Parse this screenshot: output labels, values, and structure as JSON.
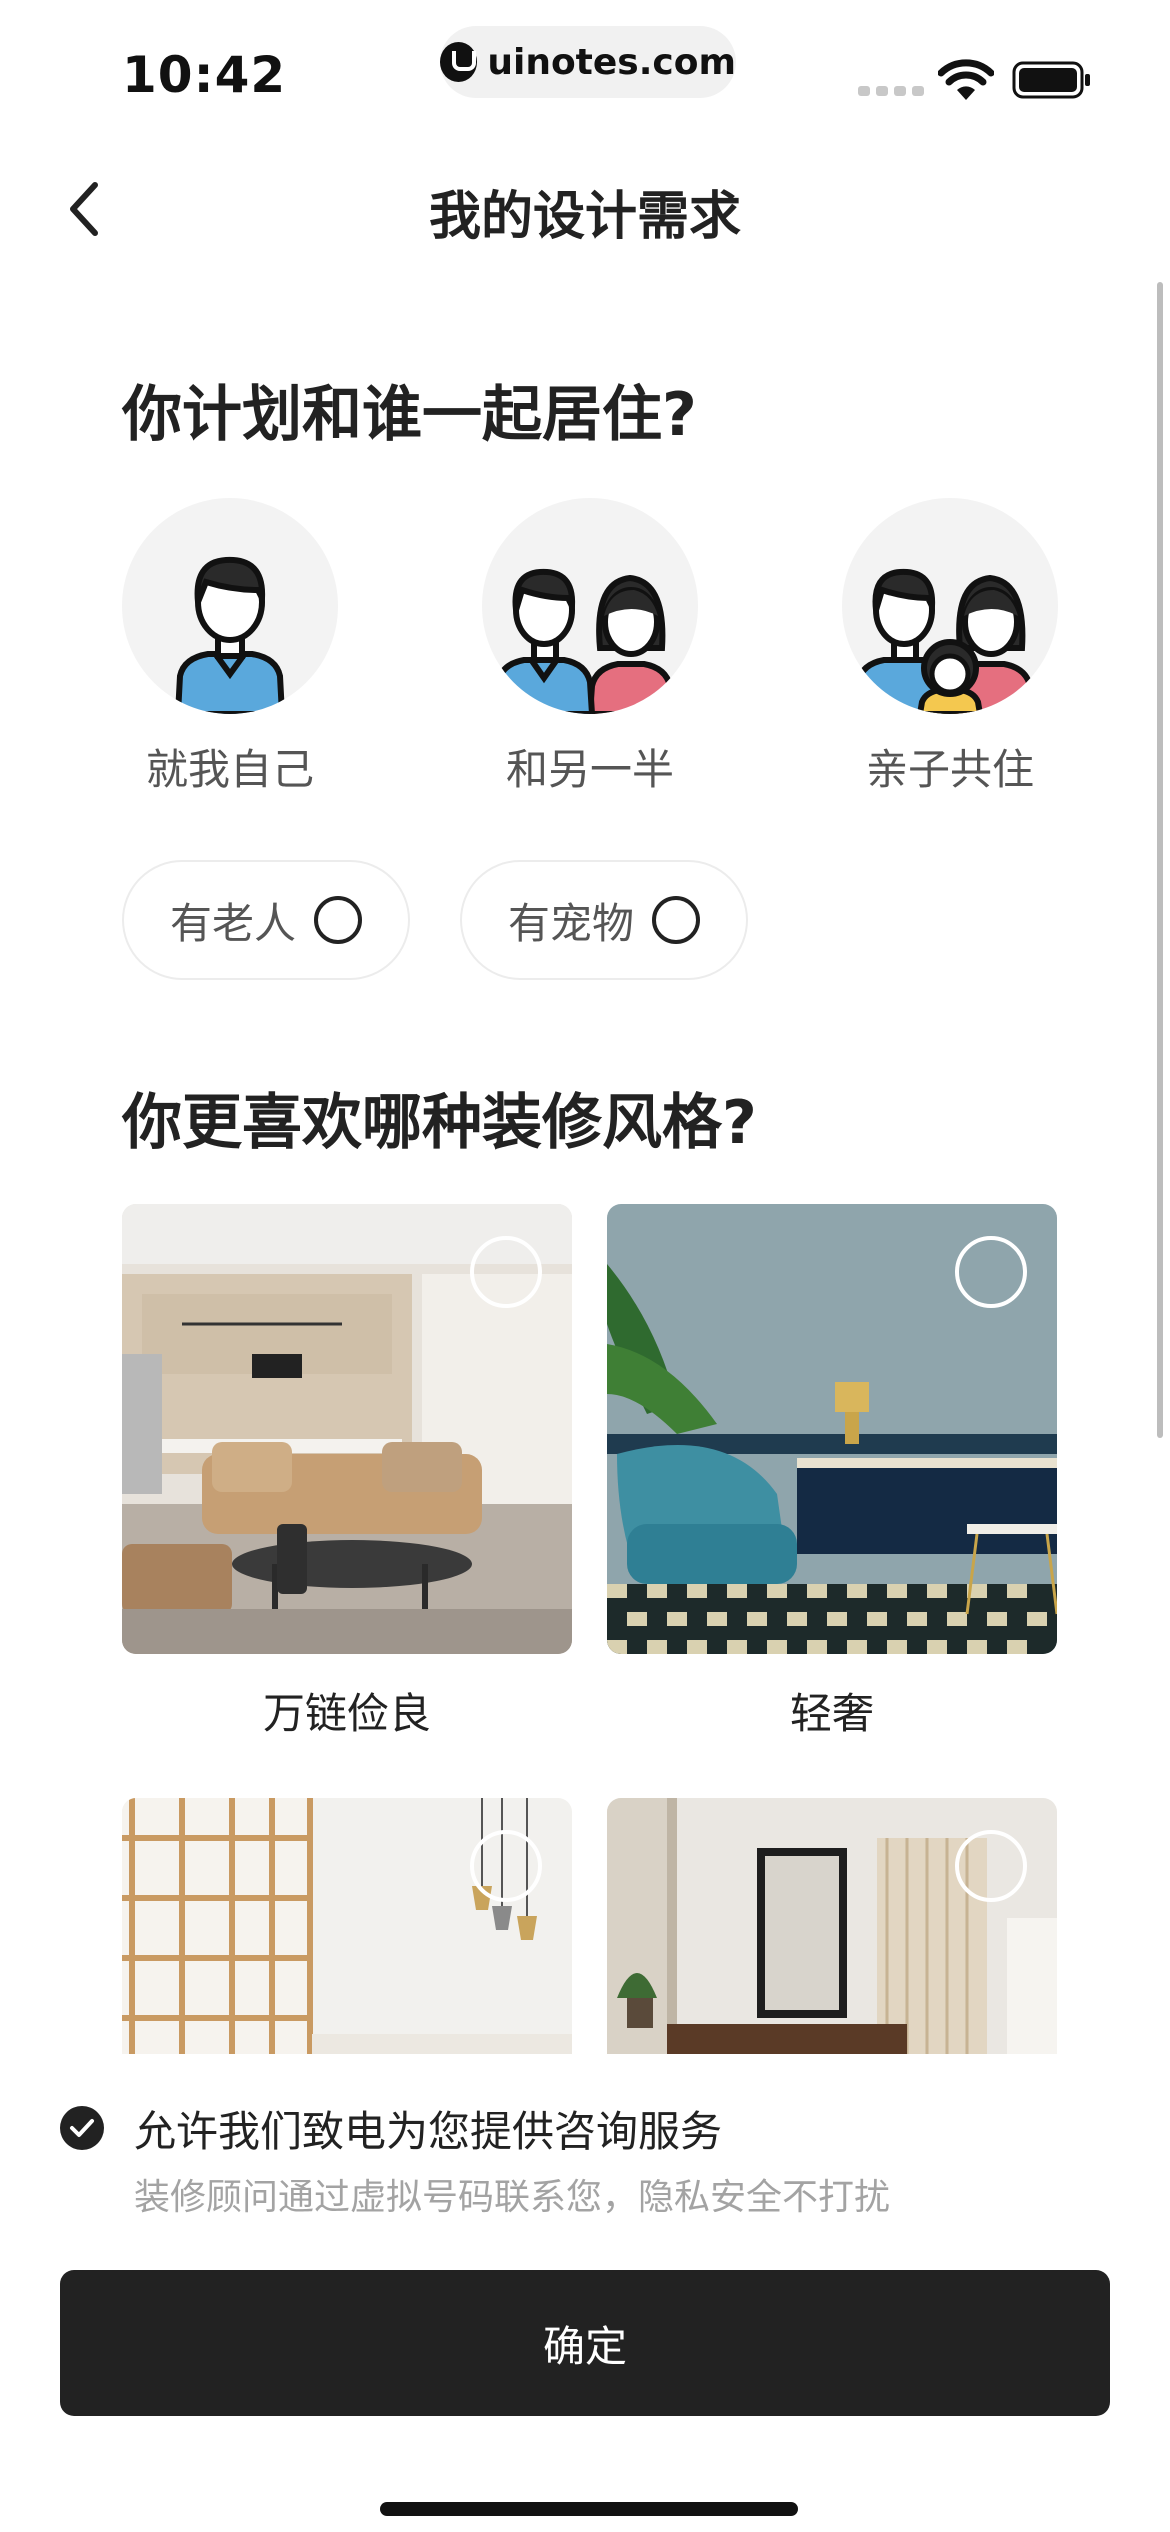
{
  "status_bar": {
    "time": "10:42",
    "url": "uinotes.com"
  },
  "nav": {
    "back_icon": "chevron-left-icon",
    "title": "我的设计需求"
  },
  "residents_section": {
    "title": "你计划和谁一起居住?",
    "options": [
      {
        "label": "就我自己",
        "icon": "single-person-icon"
      },
      {
        "label": "和另一半",
        "icon": "couple-icon"
      },
      {
        "label": "亲子共住",
        "icon": "family-icon"
      }
    ],
    "extras": [
      {
        "label": "有老人"
      },
      {
        "label": "有宠物"
      }
    ]
  },
  "style_section": {
    "title": "你更喜欢哪种装修风格?",
    "styles": [
      {
        "label": "万链俭良"
      },
      {
        "label": "轻奢"
      },
      {
        "label": ""
      },
      {
        "label": ""
      }
    ]
  },
  "consent": {
    "text": "允许我们致电为您提供咨询服务",
    "subtext": "装修顾问通过虚拟号码联系您，隐私安全不打扰"
  },
  "confirm_button": "确定",
  "colors": {
    "primary": "#222222",
    "avatar_shirt_blue": "#5aa8dc",
    "avatar_shirt_pink": "#e56f7f",
    "avatar_shirt_yellow": "#f4c84f",
    "muted_text": "#a3a3a3"
  }
}
